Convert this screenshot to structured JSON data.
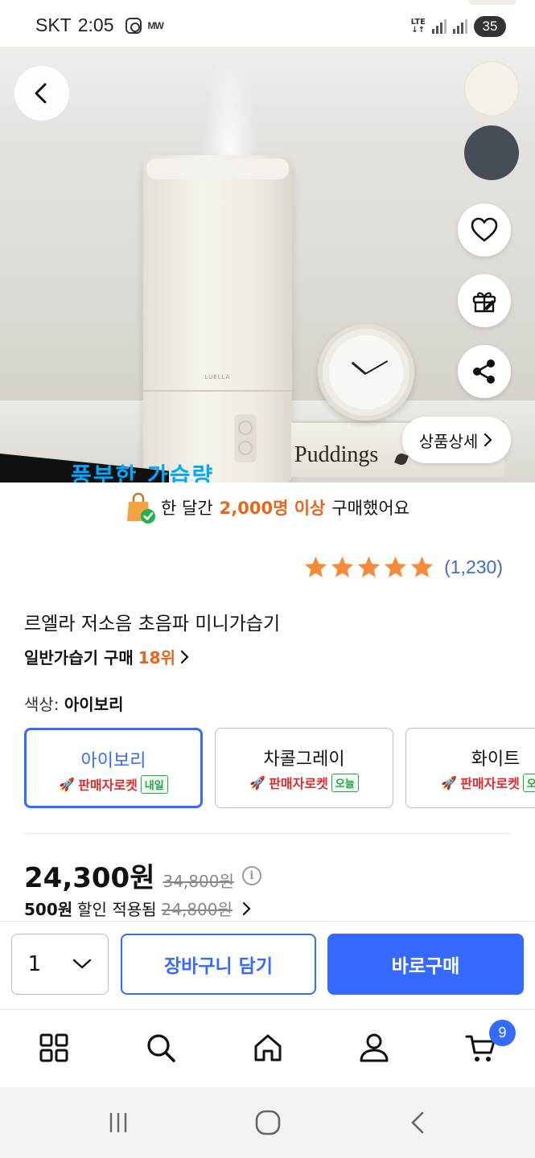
{
  "status_bar": {
    "carrier": "SKT",
    "time": "2:05",
    "network": "LTE",
    "battery": "35",
    "app_icons": [
      "instagram-icon",
      "mw-icon"
    ],
    "mw_label": "MW"
  },
  "gallery": {
    "image_description_icon": "humidifier-photo",
    "product_brand_mark": "LUELLA",
    "book_text": "Puddings",
    "banner_text": "풍부한 가습량",
    "detail_button_label": "상품상세",
    "page_dots": 8,
    "active_dot_index": 7,
    "swatch_colors": [
      "#f6f1e8",
      "#474d56"
    ]
  },
  "social_proof": {
    "prefix": "한 달간",
    "highlight": "2,000명 이상",
    "suffix": "구매했어요"
  },
  "rating": {
    "stars": 5,
    "star_color": "#f6893a",
    "count_label": "(1,230)"
  },
  "product": {
    "title": "르엘라 저소음 초음파 미니가습기",
    "rank_category": "일반가습기 구매",
    "rank_position": "18위"
  },
  "options": {
    "label_prefix": "색상:",
    "selected_value": "아이보리",
    "items": [
      {
        "name": "아이보리",
        "delivery": "판매자로켓",
        "badge": "내일",
        "selected": true
      },
      {
        "name": "차콜그레이",
        "delivery": "판매자로켓",
        "badge": "오늘",
        "selected": false
      },
      {
        "name": "화이트",
        "delivery": "판매자로켓",
        "badge": "오늘",
        "selected": false
      }
    ]
  },
  "price": {
    "sale_price": "24,300원",
    "original_price": "34,800원",
    "discount_amount": "500원",
    "discount_text": "할인 적용됨",
    "discount_base_price": "24,800원"
  },
  "actions": {
    "quantity": "1",
    "add_to_cart": "장바구니 담기",
    "buy_now": "바로구매",
    "accent_color": "#346aff"
  },
  "tab_bar": {
    "items": [
      "category-icon",
      "search-icon",
      "home-icon",
      "my-account-icon",
      "cart-icon"
    ],
    "cart_count": "9"
  },
  "system_nav": {
    "items": [
      "recent-apps-icon",
      "home-circle-icon",
      "back-icon"
    ]
  }
}
